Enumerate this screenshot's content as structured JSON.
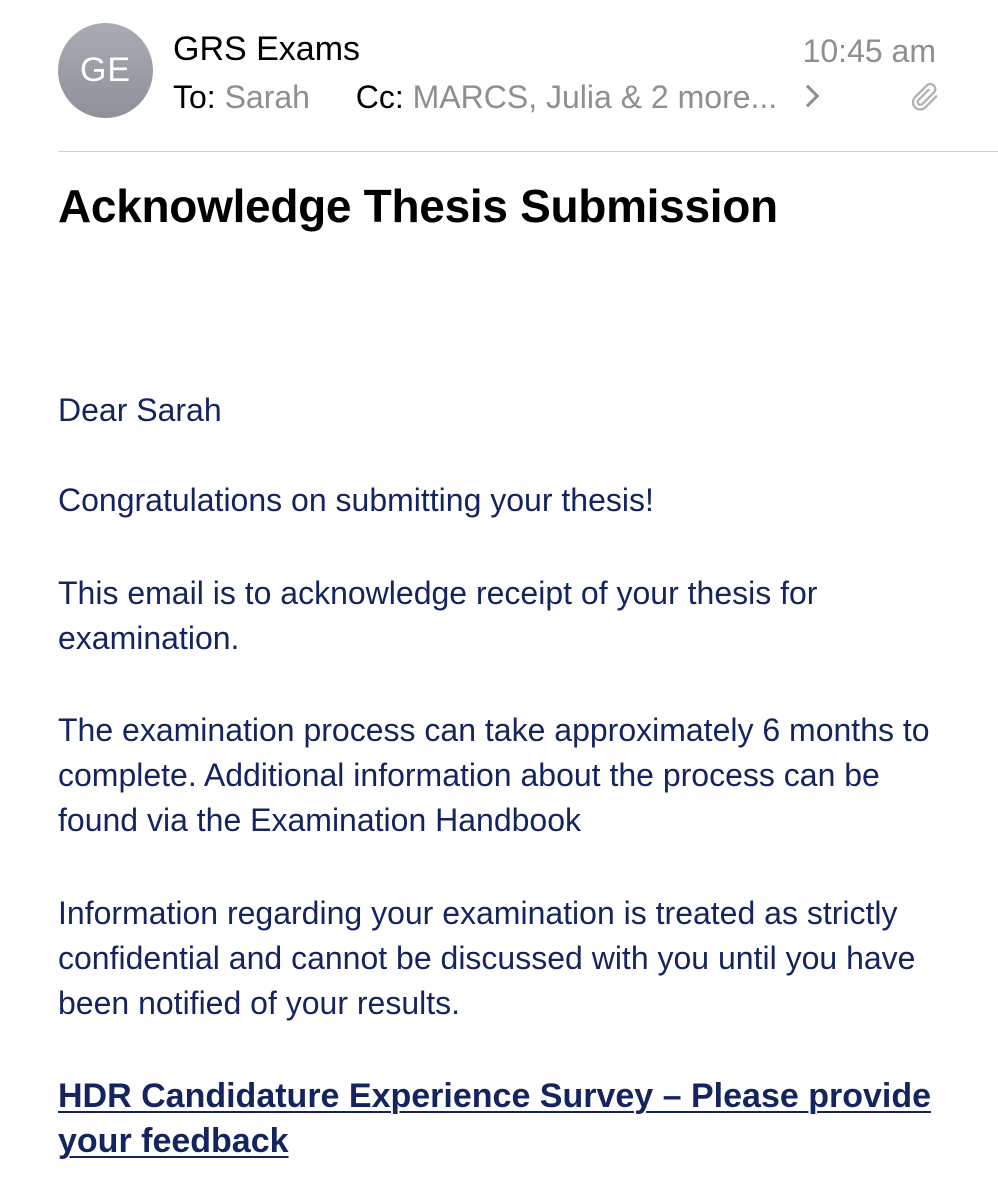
{
  "email": {
    "avatar_initials": "GE",
    "sender": "GRS Exams",
    "time": "10:45 am",
    "to_label": "To:",
    "to_value": "Sarah",
    "cc_label": "Cc:",
    "cc_value": "MARCS, Julia & 2 more...",
    "subject": "Acknowledge Thesis Submission",
    "body": {
      "greeting": "Dear Sarah",
      "congrats": "Congratulations on submitting your thesis!",
      "receipt": "This email is to acknowledge receipt of your thesis for examination.",
      "process": "The examination process can take approximately 6 months to complete. Additional information about the process can be found via the Examination Handbook",
      "confidential": "Information regarding your examination is treated as strictly confidential and cannot be discussed with you until you have been notified of your results.",
      "survey_link": "HDR Candidature Experience Survey – Please provide your feedback"
    }
  },
  "icons": {
    "chevron": "chevron-right-icon",
    "attachment": "paperclip-icon"
  },
  "colors": {
    "body_text": "#14245e",
    "secondary_text": "#8e8e93",
    "avatar_bg": "#9c9fa6"
  }
}
